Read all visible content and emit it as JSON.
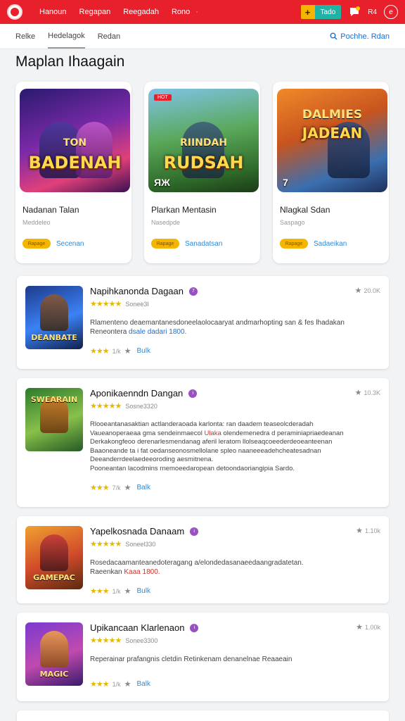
{
  "header": {
    "nav": [
      "Hanoun",
      "Regapan",
      "Reegadah",
      "Rono"
    ],
    "nav_dot": "·",
    "add_label": "Tado",
    "lang": "R4",
    "colors": {
      "bar": "#e8202b",
      "accent": "#f5b400",
      "teal": "#1fb3a6"
    }
  },
  "subnav": {
    "items": [
      "Relke",
      "Hedelagok",
      "Redan"
    ],
    "search_label": "Pochhe. Rdan"
  },
  "page_title": "Maplan Ihaagain",
  "featured": [
    {
      "art_top": "TON",
      "art": "BADENAH",
      "corner": "",
      "hot": "",
      "title": "Nadanan Talan",
      "sub": "Meddeleo",
      "pill": "Rapage",
      "link": "Secenan"
    },
    {
      "art_top": "RIINDAH",
      "art": "RUDSAH",
      "corner": "ЯЖ",
      "hot": "HOT",
      "title": "Plarkan Mentasin",
      "sub": "Nasedpde",
      "pill": "Rapage",
      "link": "Sanadatsan"
    },
    {
      "art_top": "DALMIES",
      "art": "JADEAN",
      "corner": "7",
      "hot": "",
      "title": "Nlagkal Sdan",
      "sub": "Saspago",
      "pill": "Rapage",
      "link": "Sadaeikan"
    }
  ],
  "list": [
    {
      "icon_text": "DEANBATE",
      "name": "Napihkanonda Dagaan",
      "badge": "7",
      "rating_count": "Sonee3I",
      "desc": [
        "Rlamenteno deaemantanesdoneelaolocaaryat andmarhopting san & fes lhadakan",
        "Reneontera"
      ],
      "desc_highlight": "dsale dadari 1800.",
      "foot_num": "1/k",
      "foot_link": "Bulk",
      "count": "20.0K"
    },
    {
      "icon_text": "SWEARAIN",
      "name": "Aponikaenndn Dangan",
      "badge": "i",
      "rating_count": "Sosne3320",
      "desc": [
        "Rlooeantanasaktian actlanderaoada karlonta: ran daadem teaseolcderadah",
        "Vaueanoperaeaa gma sendeinmaecol",
        "Ulaka",
        "olendemenedra d peraminiapriaedeanan",
        "Derkakongfeoo derenarlesmendanag aferil leratom llolseaqcoeederdeoeanteenan",
        "Baaoneande ta i fat oedanseonosmellolane spleo naaneeeadehcheatesadnan",
        "Deeanderrdeelaedeeoroding aesmitnena.",
        "Pooneantan lacodmins rnemoeedaropean detoondaoriangipia Sardo."
      ],
      "foot_num": "7/k",
      "foot_link": "Balk",
      "count": "10.3K"
    },
    {
      "icon_text": "GAMEPAC",
      "name": "Yapelkosnada Danaam",
      "badge": "i",
      "rating_count": "Soneel330",
      "desc": [
        "Rosedacaamanteanedoteragang a/elondedasanaeedaangradatetan.",
        "Raeenkan"
      ],
      "desc_highlight": "Kaaa 1800.",
      "foot_num": "1/k",
      "foot_link": "Bulk",
      "count": "1.10k"
    },
    {
      "icon_text": "MAGIC",
      "name": "Upikancaan Klarlenaon",
      "badge": "i",
      "rating_count": "Sonee3300",
      "desc": [
        "Reperainar prafangnis cletdin Retinkenam denanelnae Reaaeain"
      ],
      "foot_num": "1/k",
      "foot_link": "Balk",
      "count": "1.00k"
    }
  ]
}
